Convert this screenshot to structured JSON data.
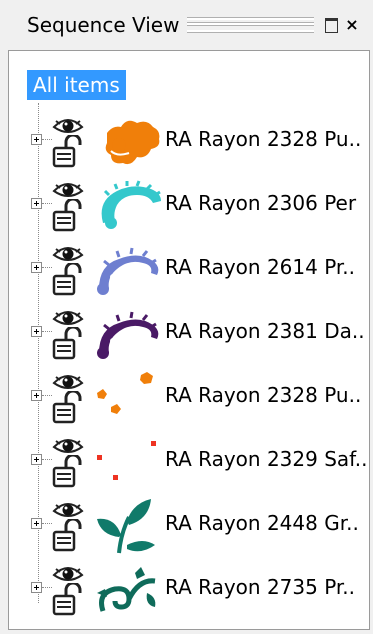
{
  "window": {
    "title": "Sequence View",
    "restore_label": "",
    "close_label": "×"
  },
  "tree": {
    "root_label": "All items",
    "items": [
      {
        "label": "RA Rayon 2328 Pu..",
        "color": "#f07f0a",
        "icon": "flower-motif"
      },
      {
        "label": "RA Rayon 2306 Per",
        "color": "#34c8cc",
        "icon": "flower-motif"
      },
      {
        "label": "RA Rayon 2614 Pr..",
        "color": "#6e7fd0",
        "icon": "scroll-motif"
      },
      {
        "label": "RA Rayon 2381 Da..",
        "color": "#4a1a66",
        "icon": "scroll-motif"
      },
      {
        "label": "RA Rayon 2328 Pu..",
        "color": "#f07f0a",
        "icon": "dots-motif"
      },
      {
        "label": "RA Rayon 2329 Saf..",
        "color": "#ee3322",
        "icon": "dots-motif"
      },
      {
        "label": "RA Rayon 2448 Gr..",
        "color": "#117a6a",
        "icon": "leaf-motif"
      },
      {
        "label": "RA Rayon 2735 Pr..",
        "color": "#0f6b5a",
        "icon": "vine-motif"
      }
    ]
  }
}
